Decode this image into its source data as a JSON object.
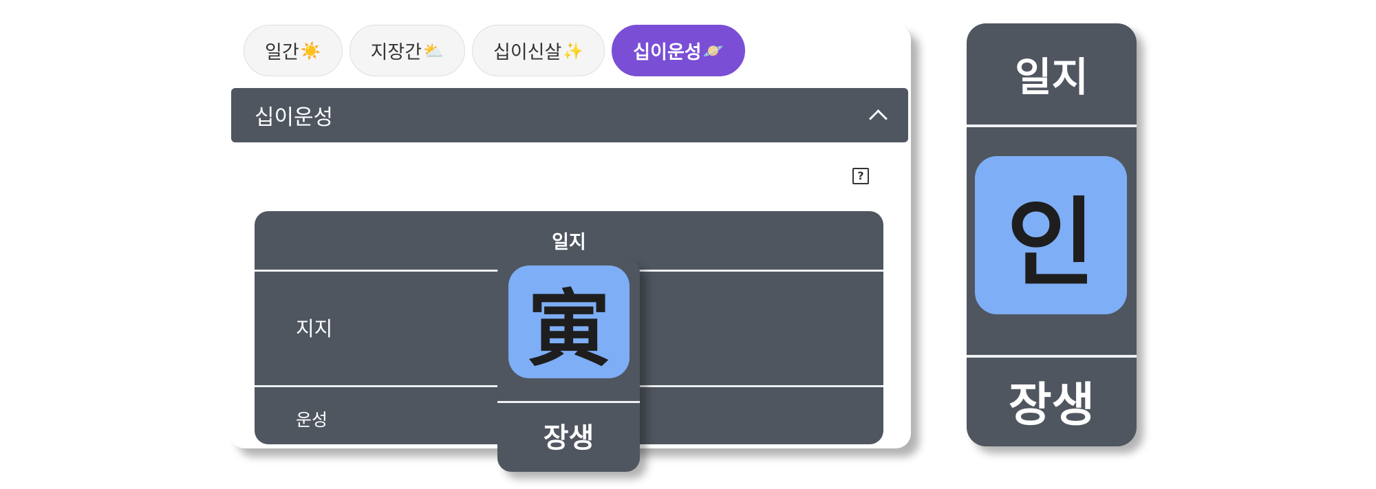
{
  "tabs": [
    {
      "label": "일간",
      "icon": "sun-icon",
      "emoji": "☀️",
      "active": false
    },
    {
      "label": "지장간",
      "icon": "sun-behind-cloud-icon",
      "emoji": "⛅",
      "active": false
    },
    {
      "label": "십이신살",
      "icon": "sparkles-icon",
      "emoji": "✨",
      "active": false
    },
    {
      "label": "십이운성",
      "icon": "ringed-planet-icon",
      "emoji": "🪐",
      "active": true
    }
  ],
  "section": {
    "title": "십이운성",
    "collapse_icon": "chevron-up-icon"
  },
  "help": {
    "label": "?"
  },
  "grid": {
    "column_header": "일지",
    "rows": [
      {
        "label": "지지"
      },
      {
        "label": "운성"
      }
    ]
  },
  "popup": {
    "hanja": "寅",
    "value": "장생"
  },
  "detail_card": {
    "title": "일지",
    "hangul": "인",
    "value": "장생"
  },
  "colors": {
    "accent": "#7a4fd6",
    "panel": "#4f5660",
    "tile": "#7eaef5"
  }
}
